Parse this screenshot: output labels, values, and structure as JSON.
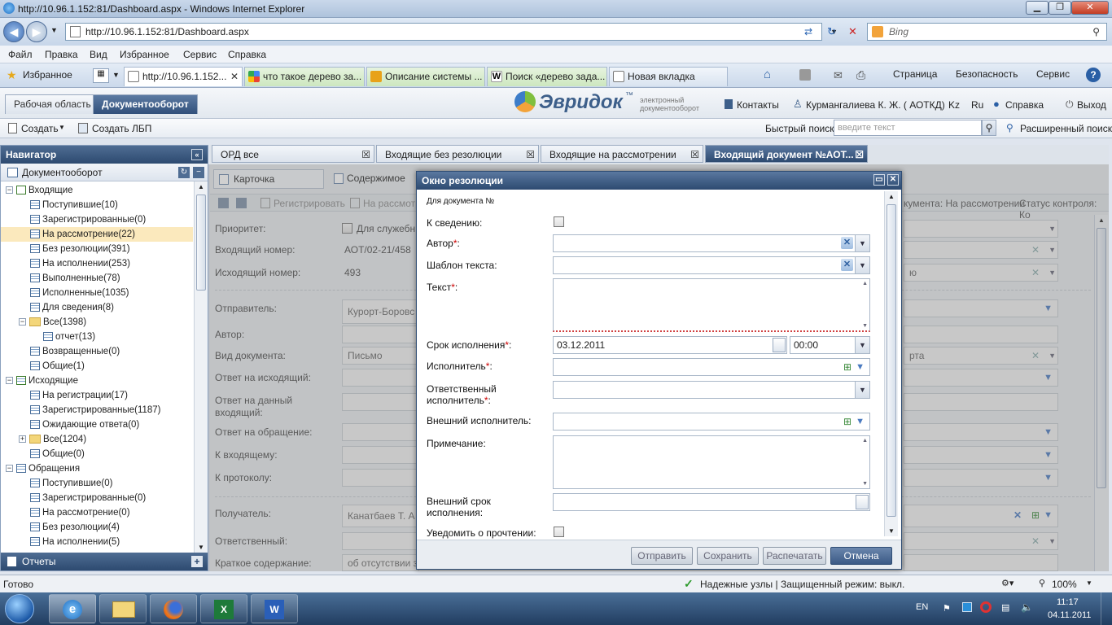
{
  "browser": {
    "title": "http://10.96.1.152:81/Dashboard.aspx - Windows Internet Explorer",
    "address": "http://10.96.1.152:81/Dashboard.aspx",
    "search_placeholder": "Bing",
    "menu": [
      "Файл",
      "Правка",
      "Вид",
      "Избранное",
      "Сервис",
      "Справка"
    ],
    "favorites": "Избранное",
    "tabs": [
      "http://10.96.1.152...",
      "что такое дерево за...",
      "Описание системы ...",
      "Поиск «дерево зада...",
      "Новая вкладка"
    ],
    "commands": [
      "Страница",
      "Безопасность",
      "Сервис"
    ],
    "status_left": "Готово",
    "status_mid": "Надежные узлы | Защищенный режим: выкл.",
    "zoom": "100%"
  },
  "app": {
    "tab_work": "Рабочая область",
    "tab_docflow": "Документооборот",
    "logo": "Эвридок",
    "logo_tm": "™",
    "logo_sub": "электронный документооборот",
    "contacts": "Контакты",
    "user": "Курмангалиева К. Ж. ( АОТКД)",
    "lang_kz": "Kz",
    "lang_ru": "Ru",
    "help": "Справка",
    "exit": "Выход",
    "create": "Создать",
    "create_lbp": "Создать ЛБП",
    "quick_search_label": "Быстрый поиск:",
    "quick_search_placeholder": "введите текст",
    "advanced_search": "Расширенный поиск"
  },
  "navigator": {
    "title": "Навигатор",
    "section": "Документооборот",
    "items": [
      {
        "label": "Входящие",
        "kind": "root"
      },
      {
        "label": "Поступившие(10)"
      },
      {
        "label": "Зарегистрированные(0)"
      },
      {
        "label": "На рассмотрение(22)",
        "selected": true
      },
      {
        "label": "Без резолюции(391)"
      },
      {
        "label": "На исполнении(253)"
      },
      {
        "label": "Выполненные(78)"
      },
      {
        "label": "Исполненные(1035)"
      },
      {
        "label": "Для сведения(8)"
      },
      {
        "label": "Все(1398)",
        "kind": "folder"
      },
      {
        "label": "отчет(13)",
        "kind": "sub"
      },
      {
        "label": "Возвращенные(0)"
      },
      {
        "label": "Общие(1)"
      },
      {
        "label": "Исходящие",
        "kind": "root"
      },
      {
        "label": "На регистрации(17)"
      },
      {
        "label": "Зарегистрированные(1187)"
      },
      {
        "label": "Ожидающие ответа(0)"
      },
      {
        "label": "Все(1204)",
        "kind": "folder"
      },
      {
        "label": "Общие(0)"
      },
      {
        "label": "Обращения",
        "kind": "root"
      },
      {
        "label": "Поступившие(0)"
      },
      {
        "label": "Зарегистрированные(0)"
      },
      {
        "label": "На рассмотрение(0)"
      },
      {
        "label": "Без резолюции(4)"
      },
      {
        "label": "На исполнении(5)"
      }
    ],
    "footer": "Отчеты"
  },
  "doc_tabs": [
    "ОРД все",
    "Входящие без резолюции",
    "Входящие на рассмотрении",
    "Входящий документ №АОТ..."
  ],
  "card": {
    "subtab1": "Карточка документа",
    "subtab2": "Содержимое",
    "register": "Регистрировать",
    "to_review": "На рассмотр",
    "status_right": "кумента: На рассмотрении",
    "control_status": "Статус контроля: Ко",
    "fields": [
      {
        "label": "Приоритет:",
        "value": "Для служебн"
      },
      {
        "label": "Входящий номер:",
        "value": "АОТ/02-21/458"
      },
      {
        "label": "Исходящий номер:",
        "value": "493"
      },
      {
        "label": "Отправитель:",
        "value": "Курорт-Боровс"
      },
      {
        "label": "Автор:",
        "value": ""
      },
      {
        "label": "Вид документа:",
        "value": "Письмо"
      },
      {
        "label": "Ответ на исходящий:",
        "value": ""
      },
      {
        "label": "Ответ на данный входящий:",
        "value": ""
      },
      {
        "label": "Ответ на обращение:",
        "value": ""
      },
      {
        "label": "К входящему:",
        "value": ""
      },
      {
        "label": "К протоколу:",
        "value": ""
      },
      {
        "label": "Получатель:",
        "value": "Канатбаев Т. А"
      },
      {
        "label": "Ответственный:",
        "value": ""
      },
      {
        "label": "Краткое содержание:",
        "value": "об отсутствии з"
      }
    ],
    "right_frag1": "ю",
    "right_frag2": "рта"
  },
  "modal": {
    "title": "Окно резолюции",
    "for_doc": "Для документа №",
    "for_info": "К сведению:",
    "author": "Автор",
    "template": "Шаблон текста:",
    "text": "Текст",
    "deadline": "Срок исполнения",
    "deadline_date": "03.12.2011",
    "deadline_time": "00:00",
    "executor": "Исполнитель",
    "responsible_1": "Ответственный",
    "responsible_2": "исполнитель",
    "external_executor": "Внешний исполнитель:",
    "note": "Примечание:",
    "external_deadline_1": "Внешний срок",
    "external_deadline_2": "исполнения:",
    "notify": "Уведомить о прочтении:",
    "btn_send": "Отправить",
    "btn_save": "Сохранить",
    "btn_print": "Распечатать",
    "btn_cancel": "Отмена"
  },
  "taskbar": {
    "lang": "EN",
    "time": "11:17",
    "date": "04.11.2011"
  }
}
